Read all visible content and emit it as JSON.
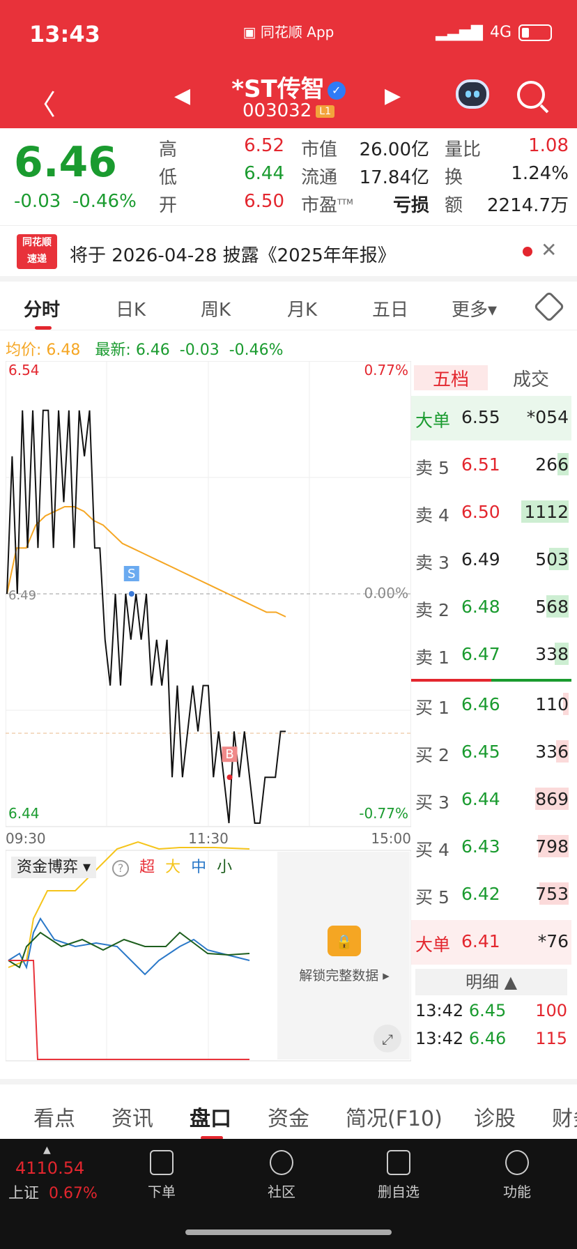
{
  "status": {
    "time": "13:43",
    "app": "同花顺 App",
    "network": "4G"
  },
  "header": {
    "title": "*ST传智",
    "code": "003032",
    "level": "L1"
  },
  "quote": {
    "price": "6.46",
    "change": "-0.03",
    "change_pct": "-0.46%",
    "high_label": "高",
    "high": "6.52",
    "low_label": "低",
    "low": "6.44",
    "open_label": "开",
    "open": "6.50",
    "mktcap_label": "市值",
    "mktcap": "26.00亿",
    "float_label": "流通",
    "float": "17.84亿",
    "pe_label": "市盈",
    "pe_sup": "TTM",
    "pe": "亏损",
    "volratio_label": "量比",
    "volratio": "1.08",
    "turnover_label": "换",
    "turnover": "1.24%",
    "amount_label": "额",
    "amount": "2214.7万"
  },
  "notice": {
    "logo_top": "同花顺",
    "logo_bottom": "速递",
    "text": "将于 2026-04-28 披露《2025年年报》"
  },
  "tabs": [
    "分时",
    "日K",
    "周K",
    "月K",
    "五日",
    "更多▾"
  ],
  "avg": {
    "avg_label": "均价:",
    "avg": "6.48",
    "latest_label": "最新:",
    "latest": "6.46",
    "chg": "-0.03",
    "pct": "-0.46%"
  },
  "chart_data": {
    "type": "line",
    "title": "",
    "y_top_label": "6.54",
    "y_bottom_label": "6.44",
    "pct_top": "0.77%",
    "pct_mid": "0.00%",
    "pct_bottom": "-0.77%",
    "y_mid_label": "6.49",
    "ylim": [
      6.44,
      6.54
    ],
    "x_labels": [
      "09:30",
      "11:30",
      "15:00"
    ],
    "series": [
      {
        "values": [
          6.49,
          6.52,
          6.49,
          6.53,
          6.5,
          6.53,
          6.5,
          6.53,
          6.53,
          6.5,
          6.53,
          6.51,
          6.53,
          6.5,
          6.53,
          6.52,
          6.53,
          6.5,
          6.5,
          6.48,
          6.47,
          6.49,
          6.47,
          6.49,
          6.48,
          6.49,
          6.48,
          6.49,
          6.47,
          6.48,
          6.47,
          6.48,
          6.45,
          6.47,
          6.45,
          6.46,
          6.47,
          6.46,
          6.47,
          6.47,
          6.45,
          6.46,
          6.45,
          6.44,
          6.46,
          6.45,
          6.46,
          6.45,
          6.44,
          6.44,
          6.45,
          6.45,
          6.45,
          6.46,
          6.46
        ]
      },
      {
        "values": [
          6.49,
          6.5,
          6.5,
          6.505,
          6.507,
          6.508,
          6.509,
          6.509,
          6.508,
          6.506,
          6.505,
          6.503,
          6.501,
          6.5,
          6.499,
          6.498,
          6.497,
          6.496,
          6.495,
          6.494,
          6.493,
          6.492,
          6.491,
          6.49,
          6.489,
          6.488,
          6.487,
          6.486,
          6.486,
          6.485
        ]
      }
    ],
    "markers": [
      {
        "label": "S",
        "index": 24,
        "value": 6.49
      },
      {
        "label": "B",
        "index": 43,
        "value": 6.45
      }
    ]
  },
  "flow": {
    "select": "资金博弈",
    "help": "?",
    "super": "超",
    "big": "大",
    "mid": "中",
    "small": "小",
    "unlock": "解锁完整数据 ▸",
    "super_color": "#e8323a",
    "big_color": "#f5c41a",
    "mid_color": "#2a78c8",
    "small_color": "#1d5e1d"
  },
  "orderbook": {
    "tab_a": "五档",
    "tab_b": "成交",
    "big_sell": {
      "label": "大单",
      "price": "6.55",
      "vol": "*054"
    },
    "sells": [
      {
        "label": "卖 5",
        "price": "6.51",
        "vol": "266",
        "color": "red",
        "bar": 0.2
      },
      {
        "label": "卖 4",
        "price": "6.50",
        "vol": "1112",
        "color": "red",
        "bar": 0.85
      },
      {
        "label": "卖 3",
        "price": "6.49",
        "vol": "503",
        "color": "black",
        "bar": 0.35
      },
      {
        "label": "卖 2",
        "price": "6.48",
        "vol": "568",
        "color": "green",
        "bar": 0.4
      },
      {
        "label": "卖 1",
        "price": "6.47",
        "vol": "338",
        "color": "green",
        "bar": 0.25
      }
    ],
    "buys": [
      {
        "label": "买 1",
        "price": "6.46",
        "vol": "110",
        "color": "green",
        "bar": 0.1
      },
      {
        "label": "买 2",
        "price": "6.45",
        "vol": "336",
        "color": "green",
        "bar": 0.22
      },
      {
        "label": "买 3",
        "price": "6.44",
        "vol": "869",
        "color": "green",
        "bar": 0.6
      },
      {
        "label": "买 4",
        "price": "6.43",
        "vol": "798",
        "color": "green",
        "bar": 0.55
      },
      {
        "label": "买 5",
        "price": "6.42",
        "vol": "753",
        "color": "green",
        "bar": 0.52
      }
    ],
    "big_buy": {
      "label": "大单",
      "price": "6.41",
      "vol": "*76"
    },
    "detail_label": "明细 ▲",
    "trades": [
      {
        "time": "13:42",
        "price": "6.45",
        "vol": "100"
      },
      {
        "time": "13:42",
        "price": "6.46",
        "vol": "115"
      }
    ]
  },
  "bottom_tabs": [
    "看点",
    "资讯",
    "盘口",
    "资金",
    "简况(F10)",
    "诊股",
    "财务"
  ],
  "dock": {
    "index_value": "4110.54",
    "index_name": "上证",
    "index_pct": "0.67%",
    "items": [
      {
        "label": "下单"
      },
      {
        "label": "社区"
      },
      {
        "label": "删自选"
      },
      {
        "label": "功能"
      }
    ]
  }
}
